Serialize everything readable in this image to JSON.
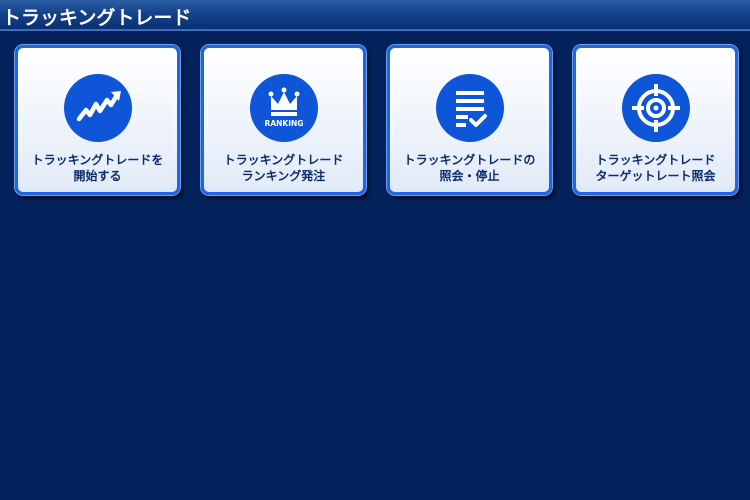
{
  "header": {
    "title": "トラッキングトレード"
  },
  "tiles": [
    {
      "icon": "rising-chart-icon",
      "line1": "トラッキングトレードを",
      "line2": "開始する"
    },
    {
      "icon": "ranking-crown-icon",
      "icon_text": "RANKING",
      "line1": "トラッキングトレード",
      "line2": "ランキング発注"
    },
    {
      "icon": "document-check-icon",
      "line1": "トラッキングトレードの",
      "line2": "照会・停止"
    },
    {
      "icon": "crosshair-target-icon",
      "line1": "トラッキングトレード",
      "line2": "ターゲットレート照会"
    }
  ],
  "colors": {
    "background": "#03215b",
    "tile_border": "#1f66e0",
    "icon_fill": "#0f55d8",
    "label_text": "#0b2d6b"
  }
}
